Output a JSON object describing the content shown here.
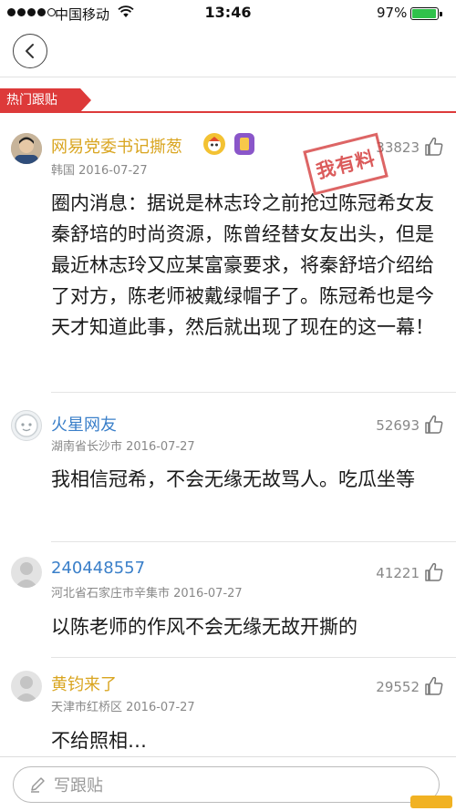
{
  "status_bar": {
    "carrier": "中国移动",
    "time": "13:46",
    "battery_percent": "97%",
    "battery_level": 0.97
  },
  "section": {
    "label": "热门跟贴"
  },
  "stamp_text": "我有料",
  "comments": [
    {
      "user": "网易党委书记撕葱",
      "location_date": "韩国 2016-07-27",
      "likes": "33823",
      "text": "圈内消息：据说是林志玲之前抢过陈冠希女友秦舒培的时尚资源，陈曾经替女友出头，但是最近林志玲又应某富豪要求，将秦舒培介绍给了对方，陈老师被戴绿帽子了。陈冠希也是今天才知道此事，然后就出现了现在的这一幕！"
    },
    {
      "user": "火星网友",
      "location_date": "湖南省长沙市 2016-07-27",
      "likes": "52693",
      "text": "我相信冠希，不会无缘无故骂人。吃瓜坐等"
    },
    {
      "user": "240448557",
      "location_date": "河北省石家庄市辛集市 2016-07-27",
      "likes": "41221",
      "text": "以陈老师的作风不会无缘无故开撕的"
    },
    {
      "user": "黄钧来了",
      "location_date": "天津市红桥区 2016-07-27",
      "likes": "29552",
      "text": "不给照相…"
    }
  ],
  "reply": {
    "placeholder": "写跟贴"
  },
  "colors": {
    "accent_red": "#dd3a3a",
    "vip_name": "#d9a520",
    "link_blue": "#3a7fc9",
    "battery_green": "#2fc24b"
  },
  "icons": [
    "back-icon",
    "like-icon",
    "edit-icon",
    "wifi-icon",
    "battery-icon"
  ]
}
